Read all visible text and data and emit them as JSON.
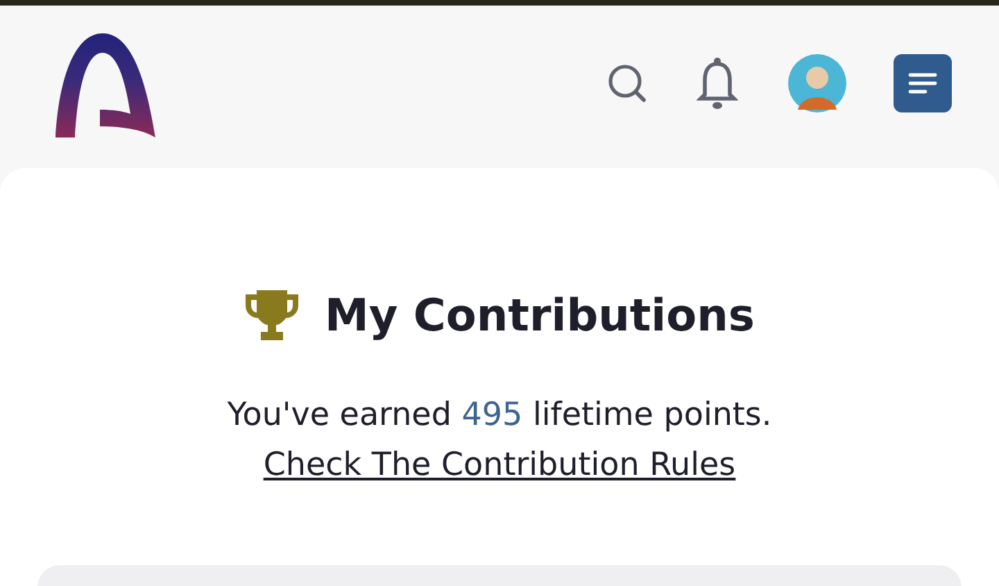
{
  "title": "My Contributions",
  "summary": {
    "prefix": "You've earned ",
    "points": "495",
    "suffix": " lifetime points."
  },
  "rules_link": "Check The Contribution Rules"
}
